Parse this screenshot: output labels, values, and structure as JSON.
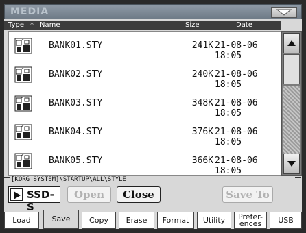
{
  "window": {
    "title": "MEDIA"
  },
  "columns": {
    "type": "Type",
    "sort_marker": "*",
    "name": "Name",
    "size": "Size",
    "date": "Date"
  },
  "files": [
    {
      "icon": "style-file-icon",
      "name": "BANK01.STY",
      "size": "241K",
      "date": "21-08-06 18:05"
    },
    {
      "icon": "style-file-icon",
      "name": "BANK02.STY",
      "size": "240K",
      "date": "21-08-06 18:05"
    },
    {
      "icon": "style-file-icon",
      "name": "BANK03.STY",
      "size": "348K",
      "date": "21-08-06 18:05"
    },
    {
      "icon": "style-file-icon",
      "name": "BANK04.STY",
      "size": "376K",
      "date": "21-08-06 18:05"
    },
    {
      "icon": "style-file-icon",
      "name": "BANK05.STY",
      "size": "366K",
      "date": "21-08-06 18:05"
    }
  ],
  "path": "[KORG SYSTEM]\\STARTUP\\ALL\\STYLE",
  "device": {
    "label": "SSD-S"
  },
  "buttons": {
    "open": "Open",
    "close": "Close",
    "save_to": "Save To"
  },
  "tabs": [
    {
      "label": "Load",
      "active": false
    },
    {
      "label": "Save",
      "active": true
    },
    {
      "label": "Copy",
      "active": false
    },
    {
      "label": "Erase",
      "active": false
    },
    {
      "label": "Format",
      "active": false
    },
    {
      "label": "Utility",
      "active": false
    },
    {
      "label": "Prefer-\nences",
      "active": false
    },
    {
      "label": "USB",
      "active": false
    }
  ],
  "colors": {
    "titlebar": "#7f8a96",
    "panel": "#d8d8d8",
    "header": "#3d3d3d",
    "disabled_text": "#b2b2b2"
  }
}
